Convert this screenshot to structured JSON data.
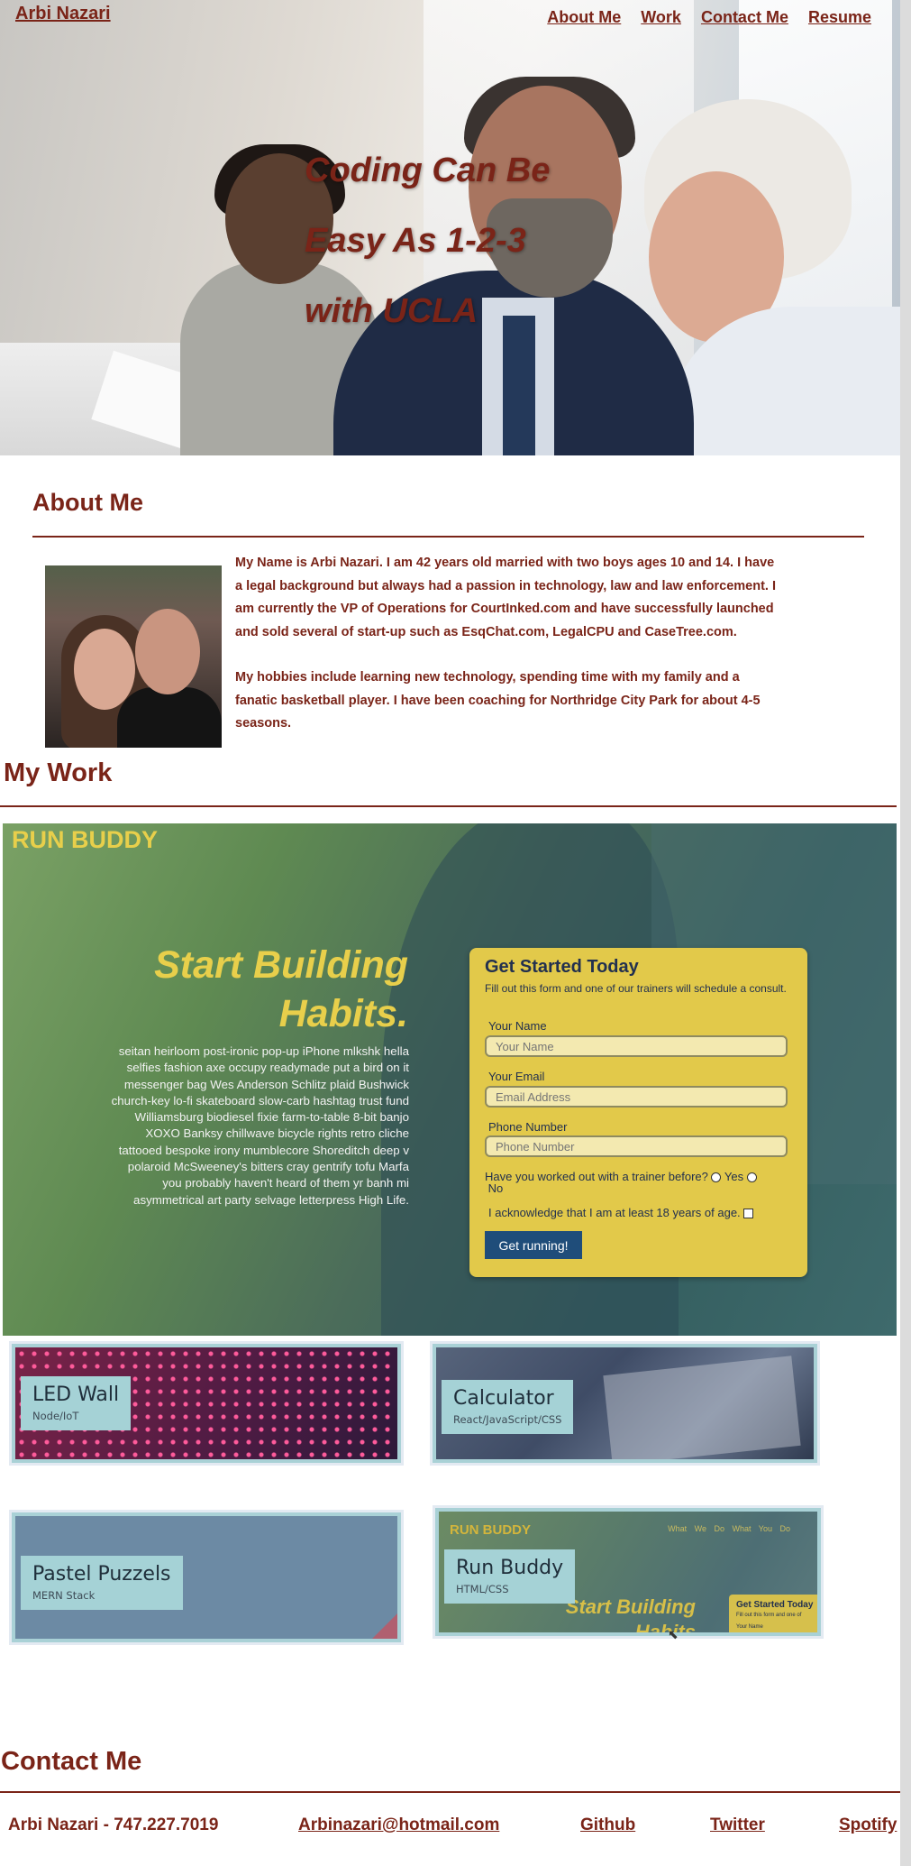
{
  "header": {
    "brand": "Arbi Nazari",
    "nav": [
      "About Me",
      "Work",
      "Contact Me",
      "Resume"
    ]
  },
  "hero": {
    "lines": [
      "Coding Can Be",
      "Easy As 1-2-3",
      "with UCLA"
    ]
  },
  "about": {
    "title": "About Me",
    "paragraphs": [
      "My Name is Arbi Nazari. I am 42 years old married with two boys ages 10 and 14. I have a legal background but always had a passion in technology, law and law enforcement. I am currently the VP of Operations for CourtInked.com and have successfully launched and sold several of start-up such as EsqChat.com, LegalCPU and CaseTree.com.",
      "My hobbies include learning new technology, spending time with my family and a fanatic basketball player. I have been coaching for Northridge City Park for about 4-5 seasons."
    ]
  },
  "work": {
    "title": "My Work",
    "featured": {
      "logo": "RUN BUDDY",
      "headline": "Start Building Habits.",
      "body": "seitan heirloom post-ironic pop-up iPhone mlkshk hella selfies fashion axe occupy readymade put a bird on it messenger bag Wes Anderson Schlitz plaid Bushwick church-key lo-fi skateboard slow-carb hashtag trust fund Williamsburg biodiesel fixie farm-to-table 8-bit banjo XOXO Banksy chillwave bicycle rights retro cliche tattooed bespoke irony mumblecore Shoreditch deep v polaroid McSweeney's bitters cray gentrify tofu Marfa you probably haven't heard of them yr banh mi asymmetrical art party selvage letterpress High Life.",
      "form": {
        "title": "Get Started Today",
        "subtitle": "Fill out this form and one of our trainers will schedule a consult.",
        "name_label": "Your Name",
        "name_placeholder": "Your Name",
        "email_label": "Your Email",
        "email_placeholder": "Email Address",
        "phone_label": "Phone Number",
        "phone_placeholder": "Phone Number",
        "trainer_question": "Have you worked out with a trainer before?",
        "yes": "Yes",
        "no": "No",
        "acknowledge": "I acknowledge that I am at least 18 years of age.",
        "button": "Get running!"
      }
    },
    "projects": [
      {
        "name": "LED Wall",
        "stack": "Node/IoT"
      },
      {
        "name": "Calculator",
        "stack": "React/JavaScript/CSS"
      },
      {
        "name": "Pastel Puzzels",
        "stack": "MERN Stack"
      },
      {
        "name": "Run Buddy",
        "stack": "HTML/CSS"
      }
    ],
    "mini_preview": {
      "logo": "RUN BUDDY",
      "nav": "What We Do   What You Do",
      "headline": "Start Building Habits",
      "form_title": "Get Started Today",
      "form_sub": "Fill out this form and one of",
      "form_field": "Your Name"
    }
  },
  "contact": {
    "title": "Contact Me",
    "name_phone": "Arbi Nazari - 747.227.7019",
    "email": "Arbinazari@hotmail.com",
    "links": [
      "Github",
      "Twitter",
      "Spotify"
    ]
  },
  "colors": {
    "accent": "#7a2418",
    "runbuddy_yellow": "#e8cf4b",
    "form_bg": "#e2c94a",
    "button_blue": "#1f4d7a",
    "card_label": "#a5d2d6"
  }
}
